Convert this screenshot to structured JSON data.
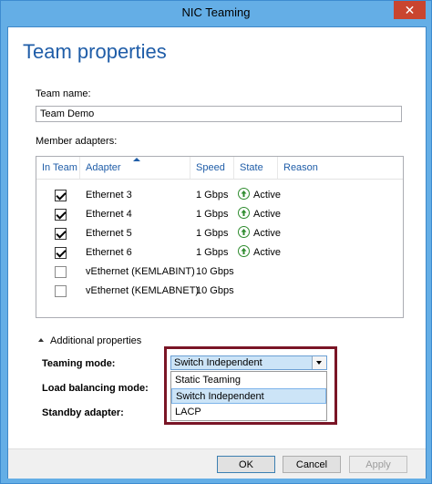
{
  "window": {
    "title": "NIC Teaming",
    "close_glyph": "✕"
  },
  "heading": "Team properties",
  "team_name": {
    "label": "Team name:",
    "value": "Team Demo"
  },
  "member_adapters": {
    "label": "Member adapters:",
    "columns": [
      "In Team",
      "Adapter",
      "Speed",
      "State",
      "Reason"
    ],
    "rows": [
      {
        "checked": true,
        "adapter": "Ethernet 3",
        "speed": "1 Gbps",
        "state": "Active",
        "reason": ""
      },
      {
        "checked": true,
        "adapter": "Ethernet 4",
        "speed": "1 Gbps",
        "state": "Active",
        "reason": ""
      },
      {
        "checked": true,
        "adapter": "Ethernet 5",
        "speed": "1 Gbps",
        "state": "Active",
        "reason": ""
      },
      {
        "checked": true,
        "adapter": "Ethernet 6",
        "speed": "1 Gbps",
        "state": "Active",
        "reason": ""
      },
      {
        "checked": false,
        "adapter": "vEthernet (KEMLABINT)",
        "speed": "10 Gbps",
        "state": "",
        "reason": ""
      },
      {
        "checked": false,
        "adapter": "vEthernet (KEMLABNET)",
        "speed": "10 Gbps",
        "state": "",
        "reason": ""
      }
    ]
  },
  "additional": {
    "toggle_label": "Additional properties",
    "teaming_mode_label": "Teaming mode:",
    "load_balancing_label": "Load balancing mode:",
    "standby_label": "Standby adapter:",
    "teaming_mode_value": "Switch Independent",
    "options": [
      "Static Teaming",
      "Switch Independent",
      "LACP"
    ],
    "selected_option": "Switch Independent"
  },
  "buttons": {
    "ok": "OK",
    "cancel": "Cancel",
    "apply": "Apply"
  },
  "colors": {
    "accent": "#1f5da8",
    "titlebar": "#64aee6",
    "highlight": "#7a1526",
    "active_icon": "#2e8b2e"
  }
}
